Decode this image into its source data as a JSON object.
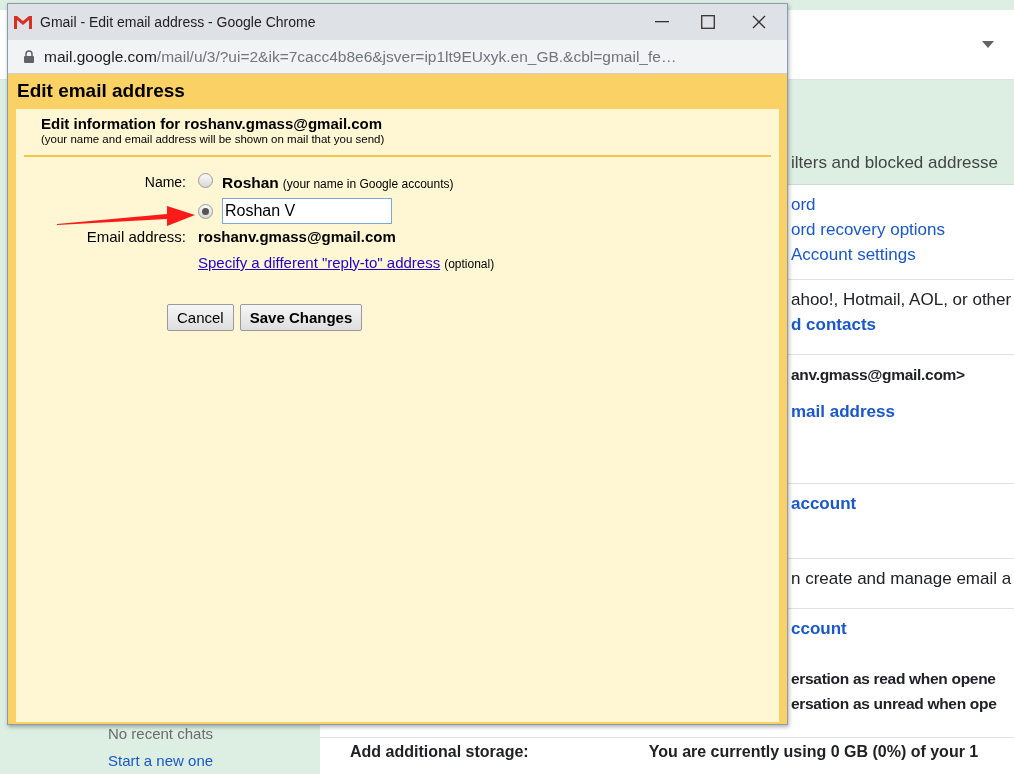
{
  "window": {
    "title": "Gmail - Edit email address - Google Chrome",
    "url_host": "mail.google.com",
    "url_path": "/mail/u/3/?ui=2&ik=7cacc4b8e6&jsver=ip1lt9EUxyk.en_GB.&cbl=gmail_fe…"
  },
  "dialog": {
    "title": "Edit email address",
    "heading": "Edit information for roshanv.gmass@gmail.com",
    "subheading": "(your name and email address will be shown on mail that you send)",
    "name_label": "Name:",
    "name_options": [
      {
        "kind": "account",
        "label": "Roshan",
        "note": "(your name in Google accounts)",
        "selected": false
      },
      {
        "kind": "custom",
        "value": "Roshan V",
        "selected": true
      }
    ],
    "email_label": "Email address:",
    "email": "roshanv.gmass@gmail.com",
    "reply_to_link": "Specify a different \"reply-to\" address",
    "reply_to_note": "(optional)",
    "buttons": [
      {
        "label": "Cancel",
        "kind": "normal"
      },
      {
        "label": "Save Changes",
        "kind": "primary"
      }
    ]
  },
  "background": {
    "tab_text": "ilters and blocked addresse",
    "sections": [
      {
        "lines": [
          {
            "kind": "link",
            "text": "ord"
          },
          {
            "kind": "link",
            "text": "ord recovery options"
          },
          {
            "kind": "link",
            "text": "Account settings"
          }
        ]
      },
      {
        "lines": [
          {
            "kind": "text",
            "text": "ahoo!, Hotmail, AOL, or other"
          },
          {
            "kind": "bold-link",
            "text": "d contacts"
          }
        ]
      },
      {
        "lines": [
          {
            "kind": "bold",
            "text": "anv.gmass@gmail.com>"
          },
          {
            "kind": "bold-link",
            "text": "mail address"
          }
        ]
      },
      {
        "lines": [
          {
            "kind": "bold-link",
            "text": "account"
          }
        ]
      },
      {
        "lines": [
          {
            "kind": "text",
            "text": "n create and manage email a"
          }
        ]
      },
      {
        "lines": [
          {
            "kind": "bold-link",
            "text": "ccount"
          },
          {
            "kind": "bold",
            "text": "ersation as read when opene"
          },
          {
            "kind": "bold",
            "text": "ersation as unread when ope"
          }
        ]
      }
    ],
    "storage_label": "Add additional storage:",
    "storage_text": "You are currently using 0 GB (0%) of your 1",
    "chats_empty": "No recent chats",
    "chats_link": "Start a new one"
  }
}
